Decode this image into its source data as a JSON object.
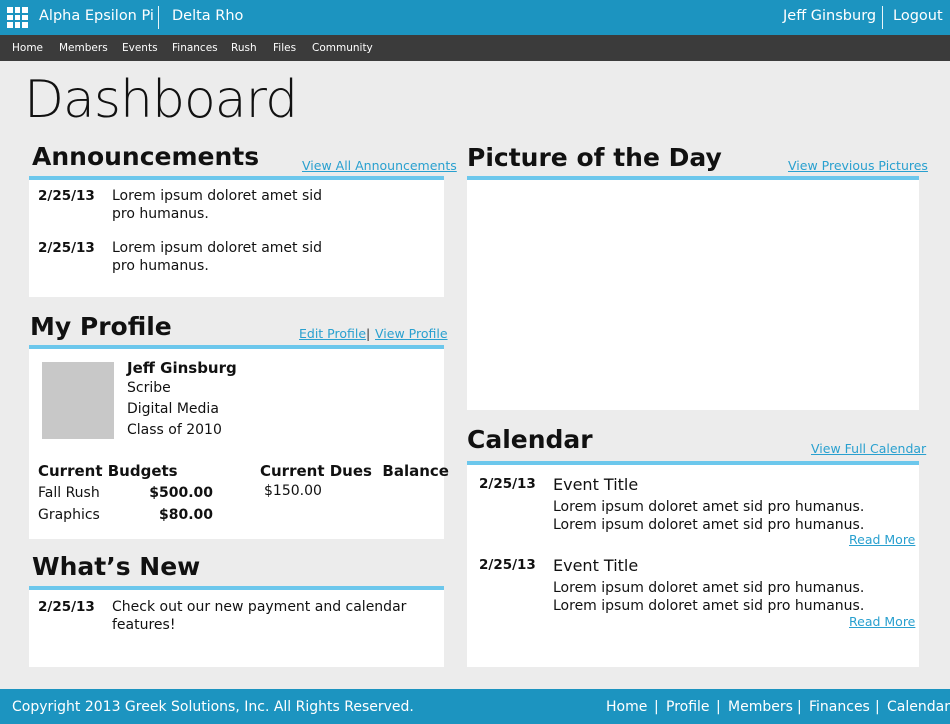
{
  "topbar": {
    "org_name": "Alpha Epsilon Pi",
    "chapter": "Delta Rho",
    "user_name": "Jeff Ginsburg",
    "logout_label": "Logout",
    "color": "#1c94c0"
  },
  "nav": {
    "items": [
      "Home",
      "Members",
      "Events",
      "Finances",
      "Rush",
      "Files",
      "Community"
    ]
  },
  "page": {
    "title": "Dashboard"
  },
  "announcements": {
    "title": "Announcements",
    "link": "View All Announcements",
    "items": [
      {
        "date": "2/25/13",
        "line1": "Lorem ipsum doloret amet sid",
        "line2": "pro humanus."
      },
      {
        "date": "2/25/13",
        "line1": "Lorem ipsum doloret amet sid",
        "line2": "pro humanus."
      }
    ]
  },
  "profile": {
    "title": "My Profile",
    "edit_link": "Edit Profile",
    "separator": "|",
    "view_link": "View Profile",
    "name": "Jeff Ginsburg",
    "role": "Scribe",
    "major": "Digital Media",
    "class": "Class of 2010",
    "budgets_title": "Current Budgets",
    "budgets": [
      {
        "label": "Fall Rush",
        "value": "$500.00"
      },
      {
        "label": "Graphics",
        "value": "$80.00"
      }
    ],
    "dues_title": "Current Dues  Balance",
    "dues_value": "$150.00"
  },
  "whats_new": {
    "title": "What’s New",
    "items": [
      {
        "date": "2/25/13",
        "line1": "Check out our new payment and calendar",
        "line2": "features!"
      }
    ]
  },
  "picture": {
    "title": "Picture of the Day",
    "link": "View Previous Pictures"
  },
  "calendar": {
    "title": "Calendar",
    "link": "View Full Calendar",
    "events": [
      {
        "date": "2/25/13",
        "title": "Event Title",
        "text": "Lorem ipsum doloret amet sid pro humanus.  Lorem ipsum doloret amet sid pro humanus.",
        "read_more": "Read More"
      },
      {
        "date": "2/25/13",
        "title": "Event Title",
        "text": "Lorem ipsum doloret amet sid pro humanus.  Lorem ipsum doloret amet sid pro humanus.",
        "read_more": "Read More"
      }
    ]
  },
  "footer": {
    "copyright": "Copyright 2013 Greek Solutions, Inc.  All Rights Reserved.",
    "separator": "|",
    "links": [
      "Home",
      "Profile",
      "Members",
      "Finances",
      "Calendar"
    ]
  },
  "colors": {
    "accent": "#1c94c0",
    "nav_bg": "#3b3b3b",
    "rule": "#6cc7ec",
    "link": "#29a0cf"
  }
}
